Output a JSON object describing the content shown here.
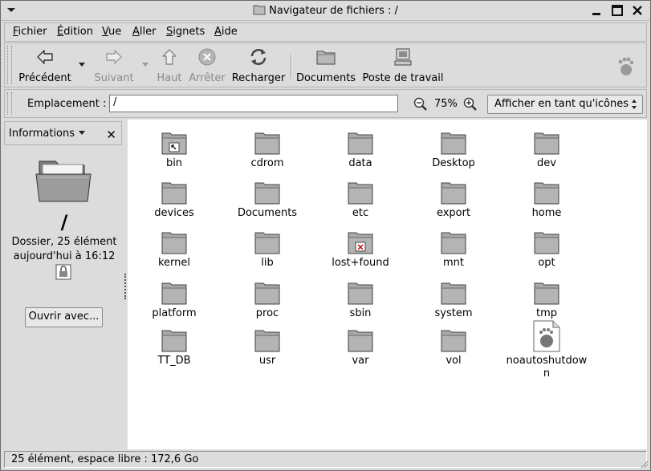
{
  "window": {
    "title": "Navigateur de fichiers : /"
  },
  "menubar": {
    "items": [
      {
        "pre": "",
        "u": "F",
        "post": "ichier"
      },
      {
        "pre": "",
        "u": "É",
        "post": "dition"
      },
      {
        "pre": "",
        "u": "V",
        "post": "ue"
      },
      {
        "pre": "",
        "u": "A",
        "post": "ller"
      },
      {
        "pre": "",
        "u": "S",
        "post": "ignets"
      },
      {
        "pre": "",
        "u": "A",
        "post": "ide"
      }
    ]
  },
  "toolbar": {
    "back": "Précédent",
    "forward": "Suivant",
    "up": "Haut",
    "stop": "Arrêter",
    "reload": "Recharger",
    "documents": "Documents",
    "workstation": "Poste de travail"
  },
  "location": {
    "label": "Emplacement :",
    "value": "/",
    "zoom": "75%",
    "view_as": "Afficher en tant qu'icônes"
  },
  "sidebar": {
    "panel_title": "Informations",
    "folder_name": "/",
    "info_line1": "Dossier, 25 élément",
    "info_line2": "aujourd'hui à 16:12",
    "open_with": "Ouvrir avec..."
  },
  "files": [
    {
      "name": "bin",
      "kind": "link"
    },
    {
      "name": "cdrom",
      "kind": "folder"
    },
    {
      "name": "data",
      "kind": "folder"
    },
    {
      "name": "Desktop",
      "kind": "folder"
    },
    {
      "name": "dev",
      "kind": "folder"
    },
    {
      "name": "devices",
      "kind": "folder"
    },
    {
      "name": "Documents",
      "kind": "folder"
    },
    {
      "name": "etc",
      "kind": "folder"
    },
    {
      "name": "export",
      "kind": "folder"
    },
    {
      "name": "home",
      "kind": "folder"
    },
    {
      "name": "kernel",
      "kind": "folder"
    },
    {
      "name": "lib",
      "kind": "folder"
    },
    {
      "name": "lost+found",
      "kind": "locked"
    },
    {
      "name": "mnt",
      "kind": "folder"
    },
    {
      "name": "opt",
      "kind": "folder"
    },
    {
      "name": "platform",
      "kind": "folder"
    },
    {
      "name": "proc",
      "kind": "folder"
    },
    {
      "name": "sbin",
      "kind": "folder"
    },
    {
      "name": "system",
      "kind": "folder"
    },
    {
      "name": "tmp",
      "kind": "folder"
    },
    {
      "name": "TT_DB",
      "kind": "folder"
    },
    {
      "name": "usr",
      "kind": "folder"
    },
    {
      "name": "var",
      "kind": "folder"
    },
    {
      "name": "vol",
      "kind": "folder"
    },
    {
      "name": "noautoshutdown",
      "kind": "file"
    }
  ],
  "statusbar": {
    "text": "25 élément, espace libre : 172,6 Go"
  }
}
